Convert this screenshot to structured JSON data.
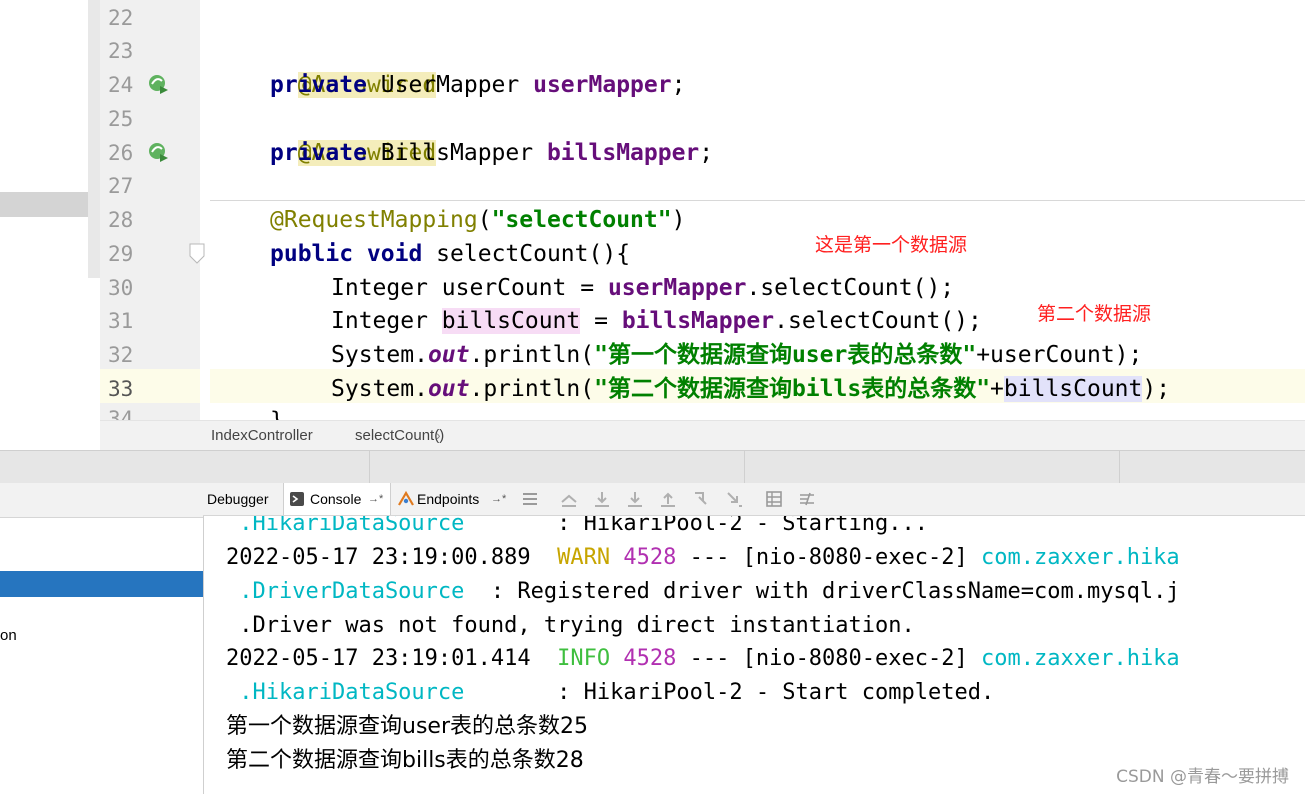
{
  "editor": {
    "line_numbers": [
      "22",
      "23",
      "24",
      "25",
      "26",
      "27",
      "28",
      "29",
      "30",
      "31",
      "32",
      "33",
      "34"
    ],
    "lines": {
      "l23_anno": "@Autowired",
      "l24_kw": "private",
      "l24_type": " UserMapper ",
      "l24_field": "userMapper",
      "l24_end": ";",
      "l25_anno": "@Autowired",
      "l26_kw": "private",
      "l26_type": " BillsMapper ",
      "l26_field": "billsMapper",
      "l26_end": ";",
      "l28_anno": "@RequestMapping",
      "l28_open": "(",
      "l28_str": "\"selectCount\"",
      "l28_close": ")",
      "l29_kw": "public void",
      "l29_rest": " selectCount(){",
      "l30_type": "Integer userCount = ",
      "l30_field": "userMapper",
      "l30_rest": ".selectCount();",
      "l31_type": "Integer ",
      "l31_var": "billsCount",
      "l31_mid": " = ",
      "l31_field": "billsMapper",
      "l31_rest": ".selectCount();",
      "l32_sys": "System.",
      "l32_out": "out",
      "l32_mid": ".println(",
      "l32_str": "\"第一个数据源查询user表的总条数\"",
      "l32_rest": "+userCount);",
      "l33_sys": "System.",
      "l33_out": "out",
      "l33_mid": ".println(",
      "l33_str": "\"第二个数据源查询bills表的总条数\"",
      "l33_plus": "+",
      "l33_var": "billsCount",
      "l33_end": ");",
      "l34_brace": "}"
    },
    "annotations": {
      "first": "这是第一个数据源",
      "second": "第二个数据源"
    }
  },
  "breadcrumb": {
    "class_name": "IndexController",
    "method_name": "selectCount()"
  },
  "toolbar": {
    "debugger_tab": "Debugger",
    "console_tab": "Console",
    "endpoints_tab": "Endpoints",
    "tab_arrow": "→*"
  },
  "debug_left": {
    "partial_text": "on"
  },
  "console": {
    "row0_cls": " .HikariDataSource",
    "row0_msg": "       : HikariPool-2 - Starting...",
    "row1_ts": "2022-05-17 23:19:00.889  ",
    "row1_level": "WARN",
    "row1_sp": " ",
    "row1_pid": "4528",
    "row1_thread": " --- [nio-8080-exec-2] ",
    "row1_logger": "com.zaxxer.hika",
    "row2_cls": " .DriverDataSource",
    "row2_msg": "  : Registered driver with driverClassName=com.mysql.j",
    "row3_msg": " .Driver was not found, trying direct instantiation.",
    "row4_ts": "2022-05-17 23:19:01.414  ",
    "row4_level": "INFO",
    "row4_sp": " ",
    "row4_pid": "4528",
    "row4_thread": " --- [nio-8080-exec-2] ",
    "row4_logger": "com.zaxxer.hika",
    "row5_cls": " .HikariDataSource",
    "row5_msg": "       : HikariPool-2 - Start completed.",
    "row6": "第一个数据源查询user表的总条数25",
    "row7": "第二个数据源查询bills表的总条数28"
  },
  "watermark": "CSDN @青春～要拼搏",
  "colors": {
    "keyword": "#000080",
    "field": "#660e7a",
    "annotation": "#808000",
    "string": "#008000",
    "note_red": "#ff2020",
    "console_cyan": "#00b7c3",
    "warn": "#c7a500",
    "info": "#3fbf3f",
    "pid": "#b130b1",
    "selection_blue": "#2675bf"
  },
  "icons": [
    "bean-run-icon",
    "fold-marker-icon",
    "console-icon",
    "endpoints-icon",
    "menu-icon",
    "scroll-up-icon",
    "download-icon",
    "download-all-icon",
    "upload-icon",
    "step-icon",
    "step-out-icon",
    "table-icon",
    "settings-icon"
  ]
}
